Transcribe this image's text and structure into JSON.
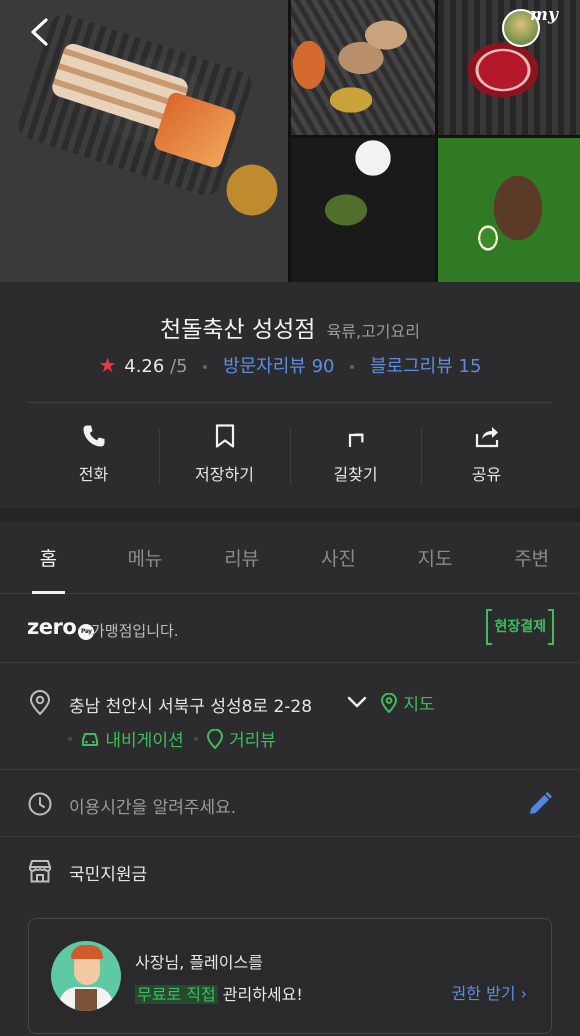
{
  "header": {
    "my_badge": "my"
  },
  "place": {
    "name": "천돌축산 성성점",
    "category": "육류,고기요리",
    "rating": "4.26",
    "rating_max": "/5",
    "visitor_reviews": "방문자리뷰 90",
    "blog_reviews": "블로그리뷰 15"
  },
  "actions": [
    {
      "label": "전화",
      "icon": "phone-icon"
    },
    {
      "label": "저장하기",
      "icon": "bookmark-icon"
    },
    {
      "label": "길찾기",
      "icon": "directions-icon"
    },
    {
      "label": "공유",
      "icon": "share-icon"
    }
  ],
  "tabs": [
    "홈",
    "메뉴",
    "리뷰",
    "사진",
    "지도",
    "주변"
  ],
  "active_tab": "홈",
  "zero_pay": {
    "logo": "zero",
    "text": "가맹점입니다.",
    "badge": "현장결제"
  },
  "address": {
    "text": "충남 천안시 서북구 성성8로 2-28",
    "map_link": "지도",
    "navigation": "내비게이션",
    "street_view": "거리뷰"
  },
  "hours": {
    "placeholder": "이용시간을 알려주세요."
  },
  "support": {
    "text": "국민지원금"
  },
  "owner_card": {
    "line1": "사장님, 플레이스를",
    "highlight": "무료로 직접",
    "line2_rest": " 관리하세요!",
    "claim": "권한 받기 ›"
  },
  "colors": {
    "background": "#2c2c2e",
    "accent_green": "#3fbd5b",
    "link_blue": "#5c8ee0",
    "star_red": "#e8394a"
  }
}
